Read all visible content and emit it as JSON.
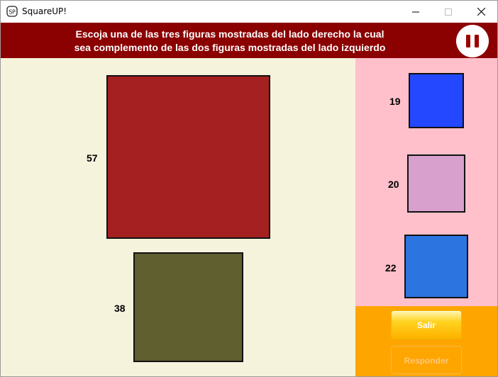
{
  "window": {
    "title": "SquareUP!"
  },
  "header": {
    "instruction_line1": "Escoja una de las tres figuras mostradas del lado derecho la cual",
    "instruction_line2": "sea complemento de las dos figuras mostradas del lado izquierdo",
    "pause_icon": "pause-icon"
  },
  "left": {
    "figures": [
      {
        "value": "57",
        "color": "#a52020"
      },
      {
        "value": "38",
        "color": "#5f5f2f"
      }
    ]
  },
  "options": [
    {
      "value": "19",
      "color": "#2448ff"
    },
    {
      "value": "20",
      "color": "#d8a0cc"
    },
    {
      "value": "22",
      "color": "#2c74e0"
    }
  ],
  "buttons": {
    "exit_label": "Salir",
    "answer_label": "Responder"
  },
  "colors": {
    "banner": "#8b0000",
    "left_bg": "#f5f3dc",
    "right_bg": "#ffc0cb",
    "buttons_bg": "#ffa500"
  }
}
